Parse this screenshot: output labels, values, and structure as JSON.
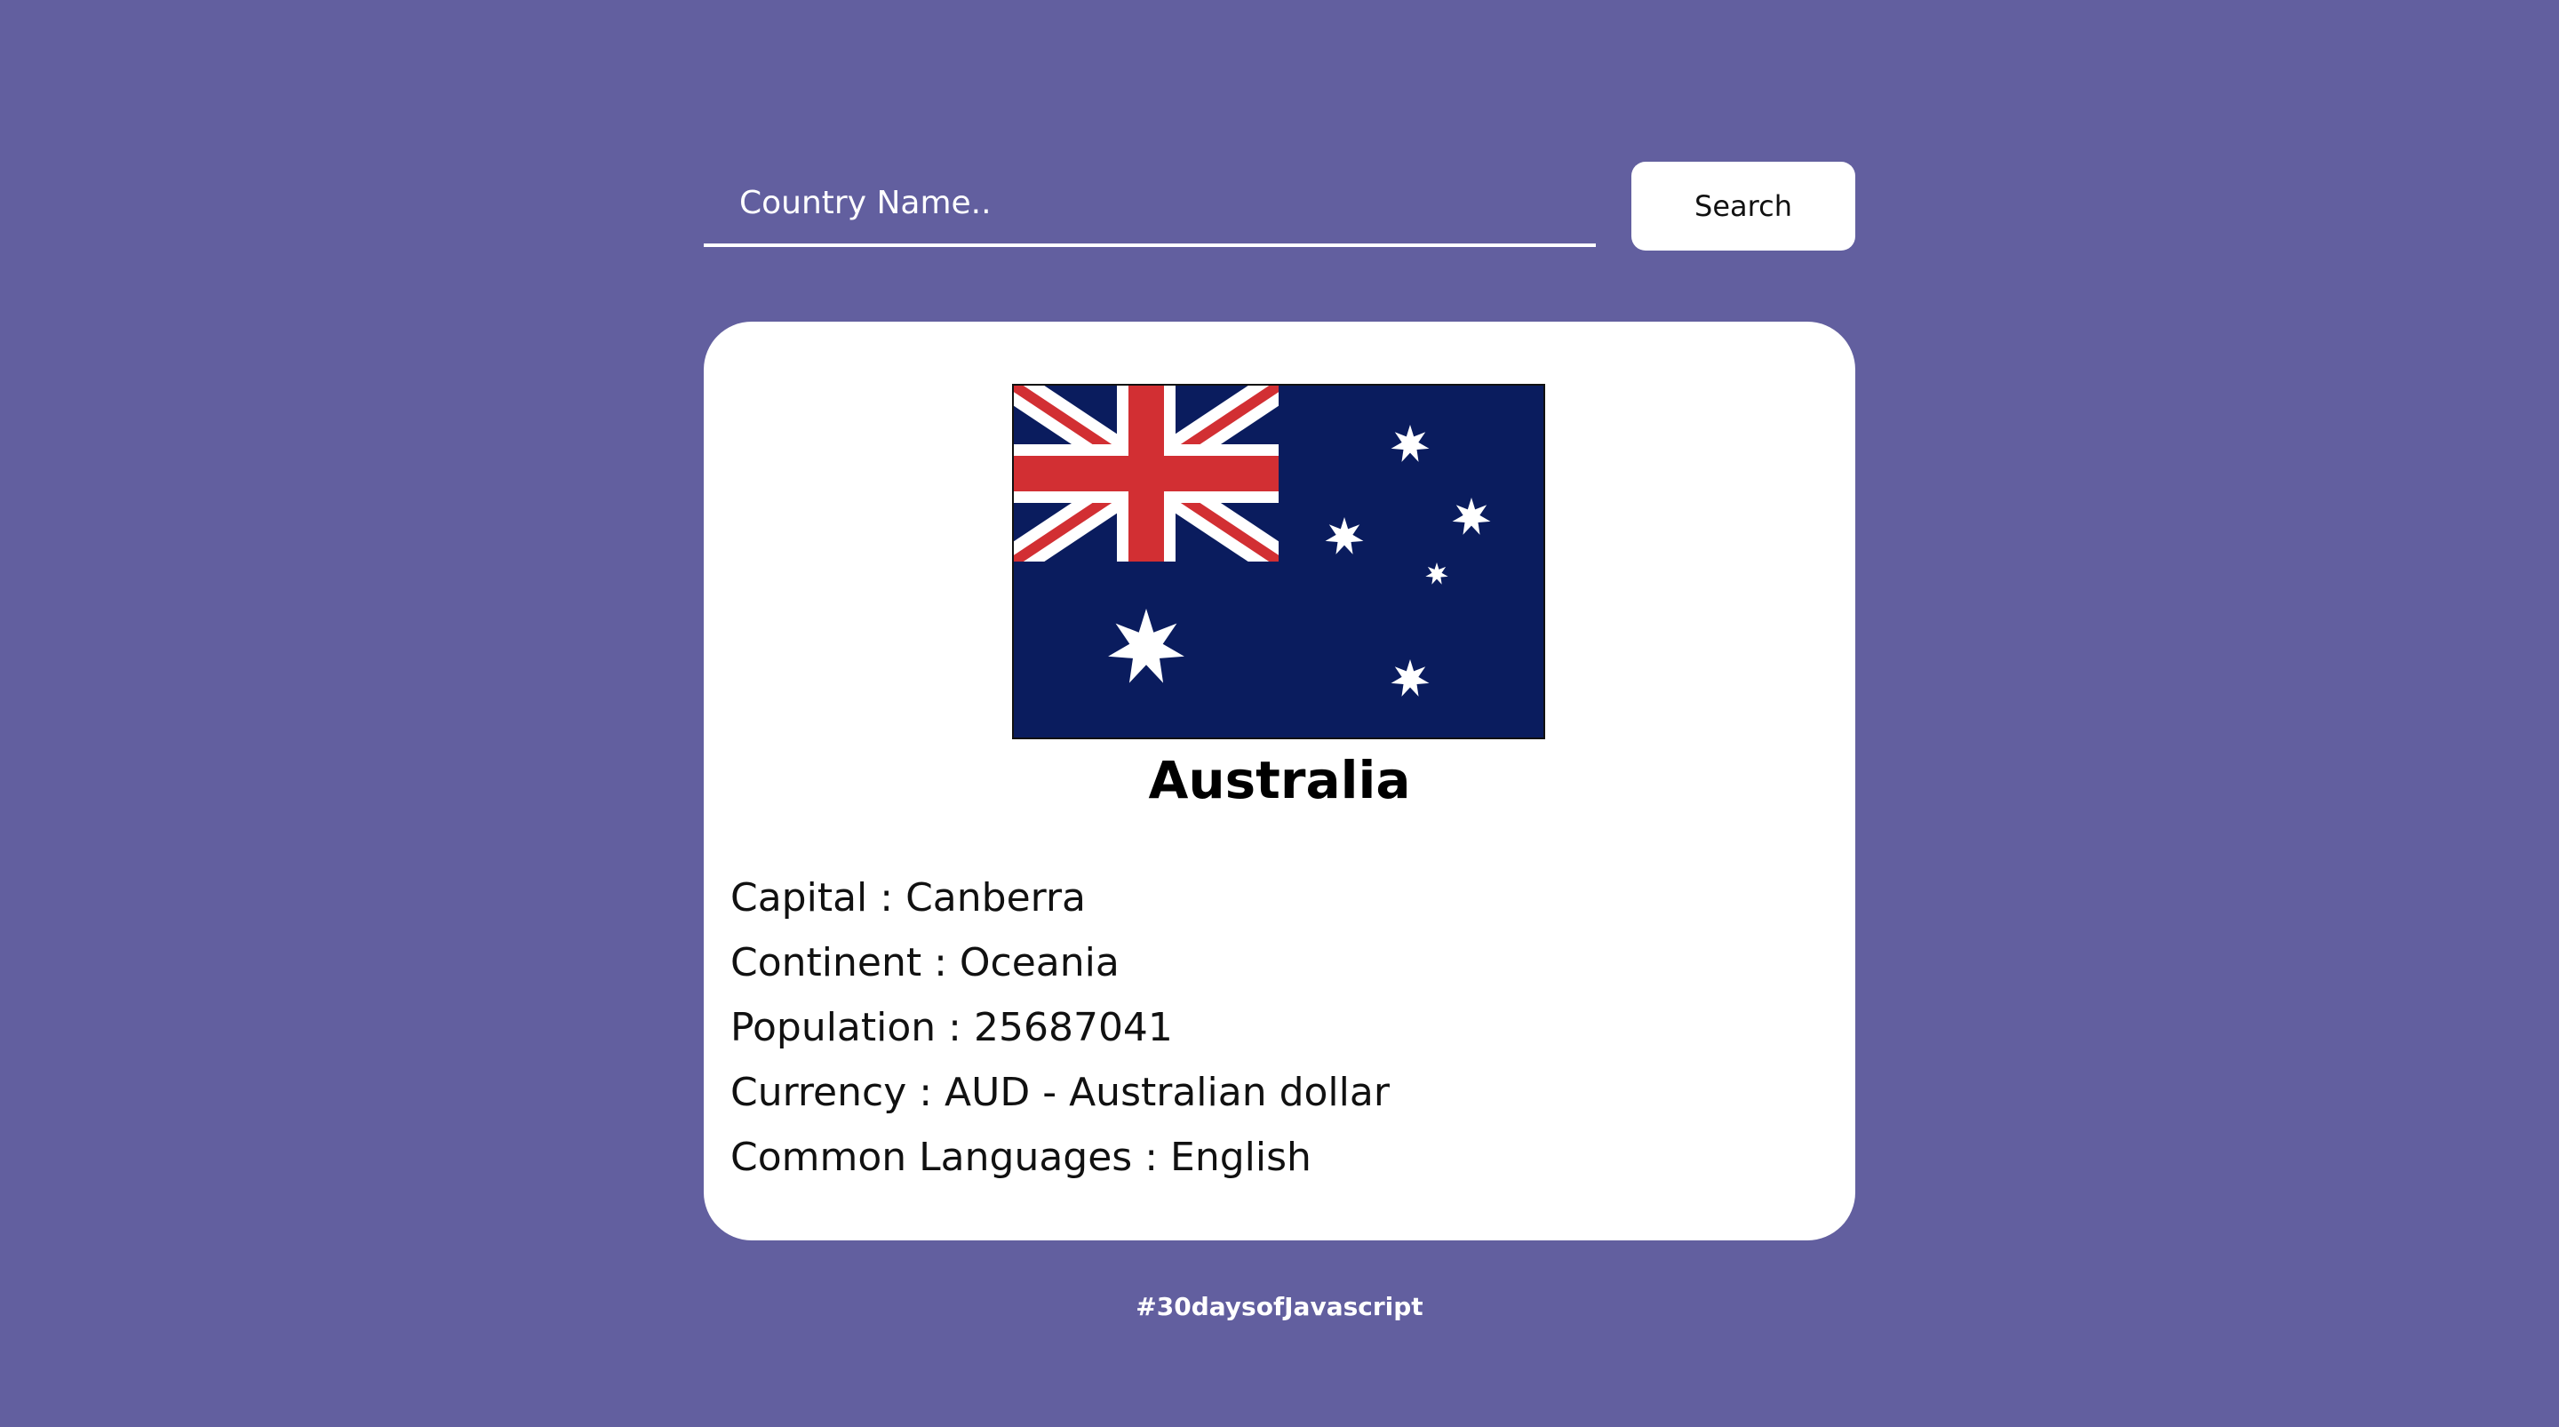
{
  "search": {
    "placeholder": "Country Name..",
    "value": "",
    "button_label": "Search"
  },
  "country": {
    "name": "Australia",
    "flag_icon": "australia-flag",
    "details": [
      {
        "label": "Capital",
        "value": "Canberra"
      },
      {
        "label": "Continent",
        "value": "Oceania"
      },
      {
        "label": "Population",
        "value": "25687041"
      },
      {
        "label": "Currency",
        "value": "AUD - Australian dollar"
      },
      {
        "label": "Common Languages",
        "value": "English"
      }
    ]
  },
  "footer": {
    "text": "#30daysofJavascript"
  },
  "colors": {
    "background": "#625f9f",
    "card": "#ffffff",
    "flag_blue": "#0a1c5e",
    "flag_red": "#d22f33"
  }
}
